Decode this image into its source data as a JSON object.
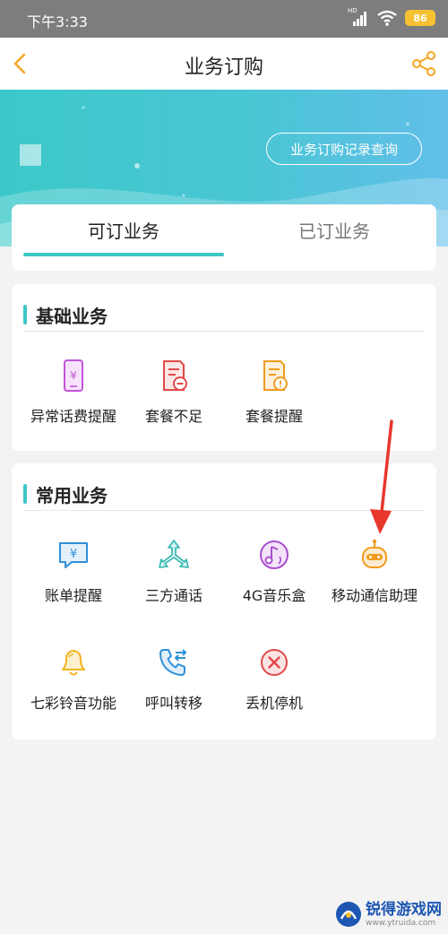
{
  "status_bar": {
    "time": "下午3:33",
    "network_label": "HD",
    "battery": "86"
  },
  "nav": {
    "title": "业务订购"
  },
  "banner": {
    "record_button": "业务订购记录查询"
  },
  "tabs": [
    {
      "label": "可订业务",
      "active": true
    },
    {
      "label": "已订业务",
      "active": false
    }
  ],
  "sections": [
    {
      "title": "基础业务",
      "items": [
        {
          "label": "异常话费提醒",
          "icon": "phone-yuan-icon"
        },
        {
          "label": "套餐不足",
          "icon": "package-minus-icon"
        },
        {
          "label": "套餐提醒",
          "icon": "package-alert-icon"
        }
      ]
    },
    {
      "title": "常用业务",
      "items": [
        {
          "label": "账单提醒",
          "icon": "bill-chat-icon"
        },
        {
          "label": "三方通话",
          "icon": "three-way-call-icon"
        },
        {
          "label": "4G音乐盒",
          "icon": "music-box-icon"
        },
        {
          "label": "移动通信助理",
          "icon": "robot-assistant-icon"
        },
        {
          "label": "七彩铃音功能",
          "icon": "bell-icon"
        },
        {
          "label": "呼叫转移",
          "icon": "call-forward-icon"
        },
        {
          "label": "丢机停机",
          "icon": "stop-x-icon"
        }
      ]
    }
  ],
  "watermark": {
    "name": "锐得游戏网",
    "url": "www.ytruida.com"
  },
  "colors": {
    "accent": "#3dc6c6",
    "nav_accent": "#f5a623",
    "arrow": "#e8382d"
  }
}
